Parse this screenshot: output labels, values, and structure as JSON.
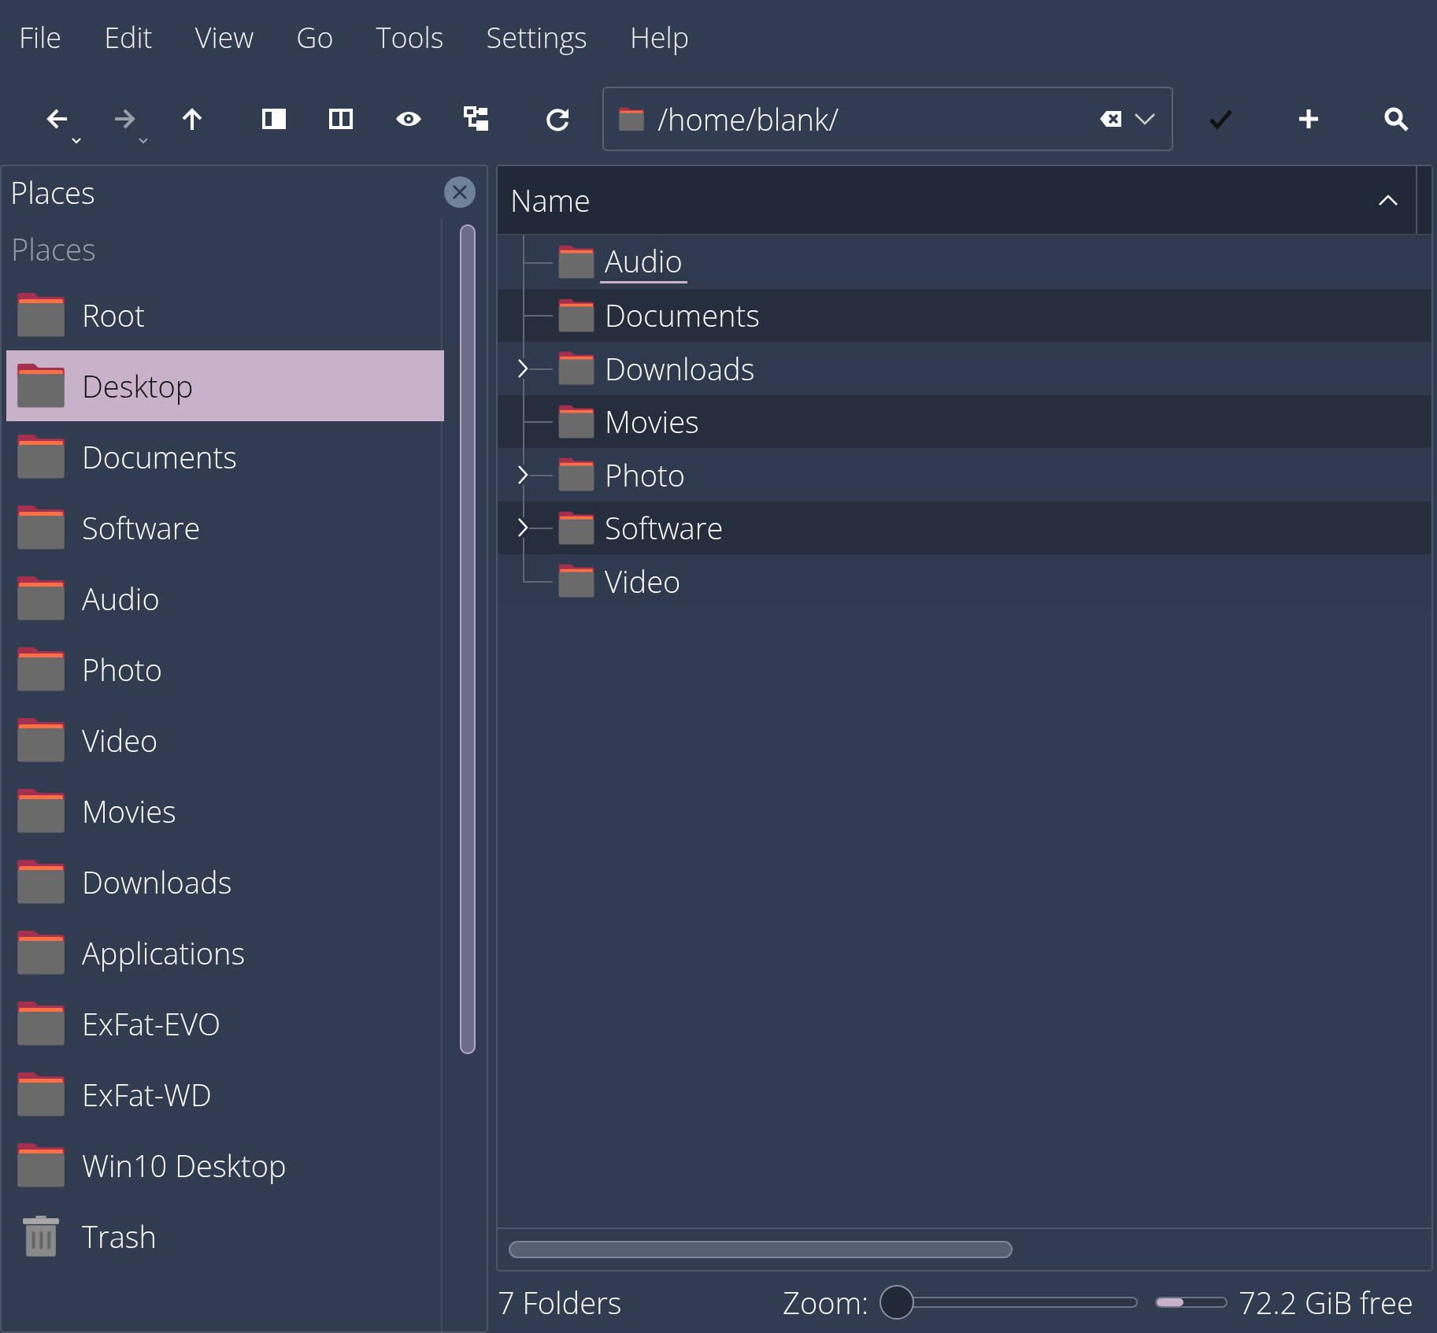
{
  "menu": [
    "File",
    "Edit",
    "View",
    "Go",
    "Tools",
    "Settings",
    "Help"
  ],
  "toolbar": [
    {
      "kind": "back",
      "disabled": false,
      "dropdown": true
    },
    {
      "kind": "forward",
      "disabled": true,
      "dropdown": true
    },
    {
      "kind": "up",
      "disabled": false,
      "dropdown": false
    },
    {
      "kind": "sidebar",
      "disabled": false,
      "dropdown": false
    },
    {
      "kind": "split",
      "disabled": false,
      "dropdown": false
    },
    {
      "kind": "preview",
      "disabled": false,
      "dropdown": false
    },
    {
      "kind": "tree",
      "disabled": false,
      "dropdown": false
    },
    {
      "kind": "reload",
      "disabled": false,
      "dropdown": false
    }
  ],
  "location": {
    "value": "/home/blank/"
  },
  "actions": [
    {
      "kind": "accept"
    },
    {
      "kind": "new"
    },
    {
      "kind": "search"
    }
  ],
  "places": {
    "title": "Places",
    "group": "Places",
    "items": [
      {
        "label": "Root",
        "kind": "folder",
        "selected": false
      },
      {
        "label": "Desktop",
        "kind": "folder",
        "selected": true
      },
      {
        "label": "Documents",
        "kind": "folder",
        "selected": false
      },
      {
        "label": "Software",
        "kind": "folder",
        "selected": false
      },
      {
        "label": "Audio",
        "kind": "folder",
        "selected": false
      },
      {
        "label": "Photo",
        "kind": "folder",
        "selected": false
      },
      {
        "label": "Video",
        "kind": "folder",
        "selected": false
      },
      {
        "label": "Movies",
        "kind": "folder",
        "selected": false
      },
      {
        "label": "Downloads",
        "kind": "folder",
        "selected": false
      },
      {
        "label": "Applications",
        "kind": "folder",
        "selected": false
      },
      {
        "label": "ExFat-EVO",
        "kind": "folder",
        "selected": false
      },
      {
        "label": "ExFat-WD",
        "kind": "folder",
        "selected": false
      },
      {
        "label": "Win10 Desktop",
        "kind": "folder",
        "selected": false
      },
      {
        "label": "Trash",
        "kind": "trash",
        "selected": false
      }
    ]
  },
  "tree": {
    "columns": [
      "Name"
    ],
    "rows": [
      {
        "name": "Audio",
        "has_children": false,
        "hovered": true
      },
      {
        "name": "Documents",
        "has_children": false,
        "hovered": false
      },
      {
        "name": "Downloads",
        "has_children": true,
        "hovered": false
      },
      {
        "name": "Movies",
        "has_children": false,
        "hovered": false
      },
      {
        "name": "Photo",
        "has_children": true,
        "hovered": false
      },
      {
        "name": "Software",
        "has_children": true,
        "hovered": false
      },
      {
        "name": "Video",
        "has_children": false,
        "hovered": false
      }
    ]
  },
  "status_bar": {
    "count": "7 Folders",
    "zoom_label": "Zoom:",
    "zoom": {
      "level": 0.04
    },
    "space": {
      "level": 0.38
    },
    "free": "72.2 GiB free"
  }
}
